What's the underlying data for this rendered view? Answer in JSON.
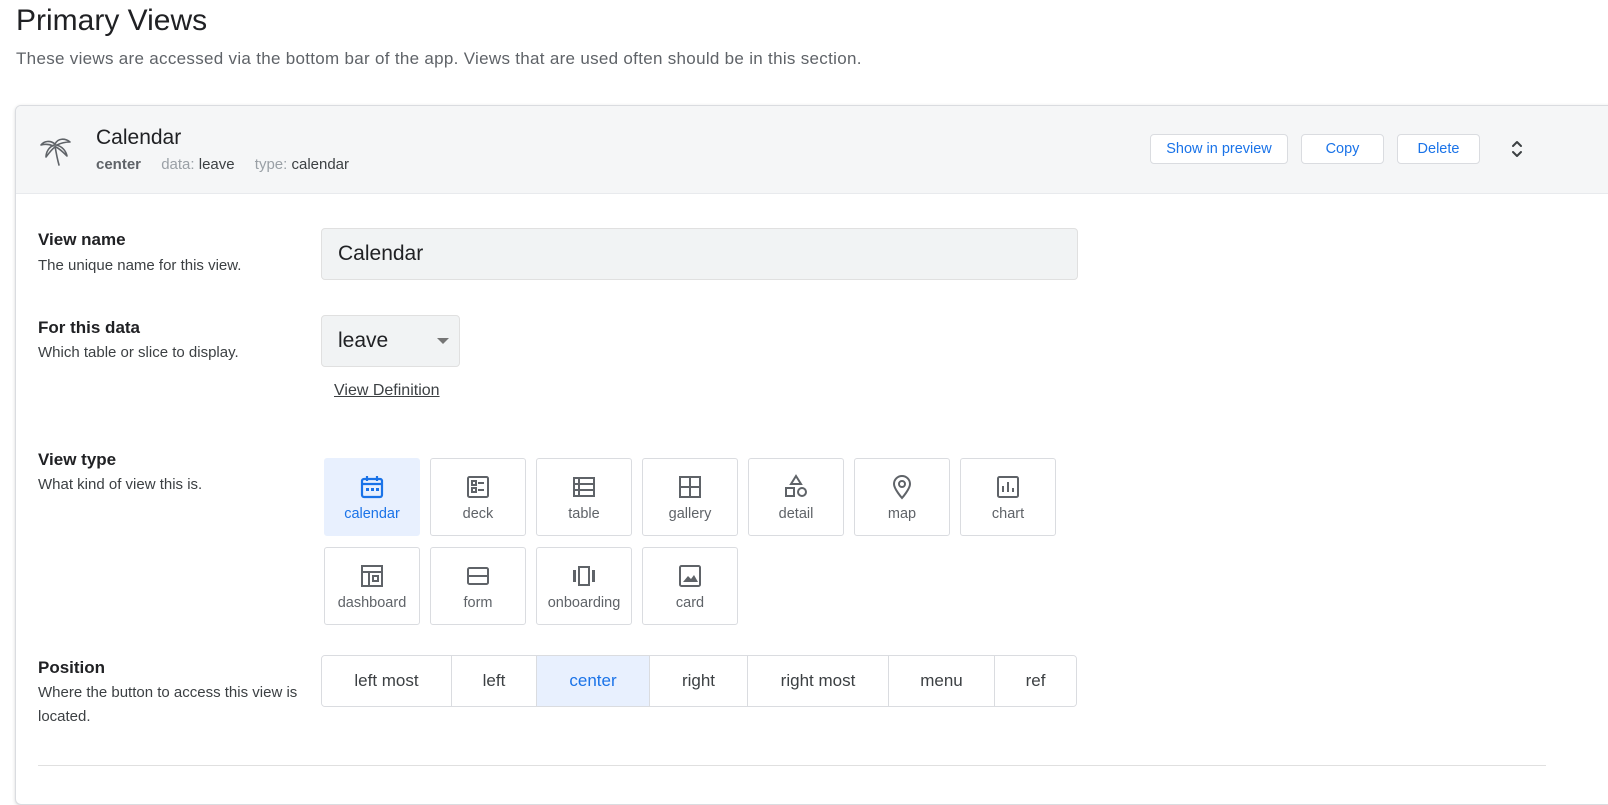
{
  "section": {
    "title": "Primary Views",
    "subtitle": "These views are accessed via the bottom bar of the app. Views that are used often should be in this section."
  },
  "view": {
    "icon": "palm-tree-icon",
    "title": "Calendar",
    "meta": {
      "position": "center",
      "data_label": "data:",
      "data_value": "leave",
      "type_label": "type:",
      "type_value": "calendar"
    },
    "actions": {
      "show_preview": "Show in preview",
      "copy": "Copy",
      "delete": "Delete"
    }
  },
  "fields": {
    "view_name": {
      "label": "View name",
      "description": "The unique name for this view.",
      "value": "Calendar"
    },
    "for_this_data": {
      "label": "For this data",
      "description": "Which table or slice to display.",
      "value": "leave",
      "link": "View Definition"
    },
    "view_type": {
      "label": "View type",
      "description": "What kind of view this is.",
      "selected": "calendar",
      "options": [
        {
          "label": "calendar",
          "icon": "calendar-icon"
        },
        {
          "label": "deck",
          "icon": "deck-icon"
        },
        {
          "label": "table",
          "icon": "table-icon"
        },
        {
          "label": "gallery",
          "icon": "gallery-icon"
        },
        {
          "label": "detail",
          "icon": "detail-icon"
        },
        {
          "label": "map",
          "icon": "map-pin-icon"
        },
        {
          "label": "chart",
          "icon": "chart-icon"
        },
        {
          "label": "dashboard",
          "icon": "dashboard-icon"
        },
        {
          "label": "form",
          "icon": "form-icon"
        },
        {
          "label": "onboarding",
          "icon": "onboarding-icon"
        },
        {
          "label": "card",
          "icon": "card-icon"
        }
      ]
    },
    "position": {
      "label": "Position",
      "description": "Where the button to access this view is located.",
      "selected": "center",
      "options": [
        "left most",
        "left",
        "center",
        "right",
        "right most",
        "menu",
        "ref"
      ]
    }
  },
  "colors": {
    "accent": "#1a73e8",
    "selected_bg": "#e8f0fe",
    "header_bg": "#f5f6f7"
  }
}
